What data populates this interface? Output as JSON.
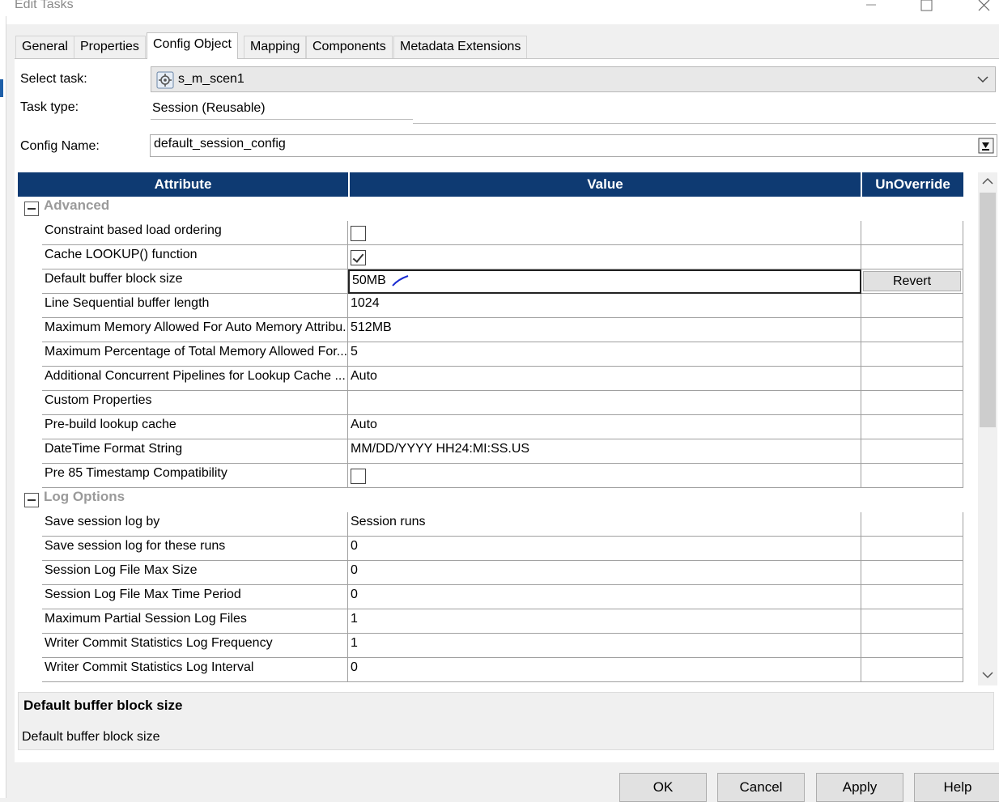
{
  "window": {
    "title": "Edit Tasks"
  },
  "tabs": [
    {
      "label": "General"
    },
    {
      "label": "Properties"
    },
    {
      "label": "Config Object",
      "active": true
    },
    {
      "label": "Mapping"
    },
    {
      "label": "Components"
    },
    {
      "label": "Metadata Extensions"
    }
  ],
  "form": {
    "select_task_label": "Select task:",
    "select_task_value": "s_m_scen1",
    "task_type_label": "Task type:",
    "task_type_value": "Session (Reusable)",
    "config_name_label": "Config Name:",
    "config_name_value": "default_session_config"
  },
  "grid": {
    "headers": {
      "attribute": "Attribute",
      "value": "Value",
      "unoverride": "UnOverride"
    },
    "groups": [
      {
        "name": "Advanced",
        "rows": [
          {
            "attribute": "Constraint based load ordering",
            "value": "",
            "checkbox": false
          },
          {
            "attribute": "Cache LOOKUP() function",
            "value": "",
            "checkbox": true
          },
          {
            "attribute": "Default buffer block size",
            "value": "50MB",
            "selected": true,
            "unoverride": "Revert"
          },
          {
            "attribute": "Line Sequential buffer length",
            "value": "1024"
          },
          {
            "attribute": "Maximum Memory Allowed For Auto Memory Attribu...",
            "value": "512MB"
          },
          {
            "attribute": "Maximum Percentage of Total Memory Allowed For...",
            "value": "5"
          },
          {
            "attribute": "Additional Concurrent Pipelines for Lookup Cache ...",
            "value": "Auto"
          },
          {
            "attribute": "Custom Properties",
            "value": ""
          },
          {
            "attribute": "Pre-build lookup cache",
            "value": "Auto"
          },
          {
            "attribute": "DateTime Format String",
            "value": "MM/DD/YYYY HH24:MI:SS.US"
          },
          {
            "attribute": "Pre 85 Timestamp Compatibility",
            "value": "",
            "checkbox": false
          }
        ]
      },
      {
        "name": "Log Options",
        "rows": [
          {
            "attribute": "Save session log by",
            "value": "Session runs"
          },
          {
            "attribute": "Save session log for these runs",
            "value": "0"
          },
          {
            "attribute": "Session Log File Max Size",
            "value": "0"
          },
          {
            "attribute": "Session Log File Max Time Period",
            "value": "0"
          },
          {
            "attribute": "Maximum Partial Session Log Files",
            "value": "1"
          },
          {
            "attribute": "Writer Commit Statistics Log Frequency",
            "value": "1"
          },
          {
            "attribute": "Writer Commit Statistics Log Interval",
            "value": "0"
          }
        ]
      }
    ]
  },
  "description": {
    "title": "Default buffer block size",
    "text": "Default buffer block size"
  },
  "buttons": {
    "ok": "OK",
    "cancel": "Cancel",
    "apply": "Apply",
    "help": "Help"
  },
  "icons": [
    "task-gear-icon",
    "dropdown-chevron-icon",
    "config-picker-icon",
    "minimize-icon",
    "maximize-icon",
    "close-icon",
    "scroll-up-icon",
    "scroll-down-icon",
    "collapse-icon"
  ],
  "colors": {
    "header_bg": "#0e3a72",
    "header_text": "#ffffff",
    "group_text": "#9a9a9a"
  }
}
